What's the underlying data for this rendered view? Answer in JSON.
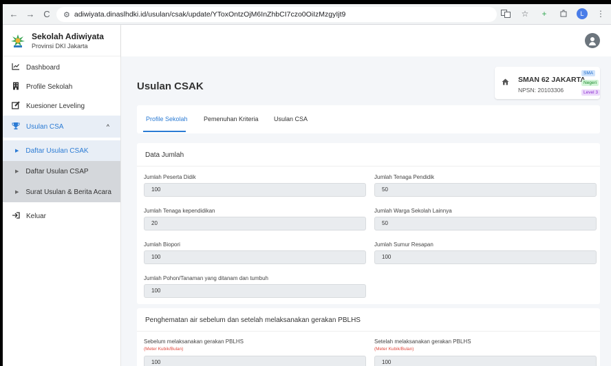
{
  "browser": {
    "url": "adiwiyata.dinaslhdki.id/usulan/csak/update/YToxOntzOjM6InZhbCI7czo0OiIzMzgyIjt9",
    "back_icon": "←",
    "forward_icon": "→",
    "reload_icon": "C",
    "profile_initial": "L"
  },
  "brand": {
    "title": "Sekolah Adiwiyata",
    "subtitle": "Provinsi DKI Jakarta"
  },
  "sidebar": {
    "items": [
      {
        "label": "Dashboard",
        "icon": "chart-line-icon"
      },
      {
        "label": "Profile Sekolah",
        "icon": "building-icon"
      },
      {
        "label": "Kuesioner Leveling",
        "icon": "edit-icon"
      },
      {
        "label": "Usulan CSA",
        "icon": "trophy-icon"
      },
      {
        "label": "Keluar",
        "icon": "logout-icon"
      }
    ],
    "subitems": [
      {
        "label": "Daftar Usulan CSAK"
      },
      {
        "label": "Daftar Usulan CSAP"
      },
      {
        "label": "Surat Usulan & Berita Acara"
      }
    ]
  },
  "page": {
    "title": "Usulan CSAK"
  },
  "school": {
    "name": "SMAN 62 JAKARTA",
    "npsn": "NPSN: 20103306",
    "badges": [
      "SMA",
      "Negeri",
      "Level 3"
    ]
  },
  "tabs": [
    {
      "label": "Profile Sekolah"
    },
    {
      "label": "Pemenuhan Kriteria"
    },
    {
      "label": "Usulan CSA"
    }
  ],
  "data_jumlah": {
    "title": "Data Jumlah",
    "fields": [
      {
        "label": "Jumlah Peserta Didik",
        "value": "100"
      },
      {
        "label": "Jumlah Tenaga Pendidik",
        "value": "50"
      },
      {
        "label": "Jumlah Tenaga kependidikan",
        "value": "20"
      },
      {
        "label": "Jumlah Warga Sekolah Lainnya",
        "value": "50"
      },
      {
        "label": "Jumlah Biopori",
        "value": "100"
      },
      {
        "label": "Jumlah Sumur Resapan",
        "value": "100"
      },
      {
        "label": "Jumlah Pohon/Tanaman yang ditanam dan tumbuh",
        "value": "100"
      }
    ]
  },
  "penghematan": {
    "title": "Penghematan air sebelum dan setelah melaksanakan gerakan PBLHS",
    "fields": [
      {
        "label": "Sebelum melaksanakan gerakan PBLHS",
        "hint": "(Meter Kubik/Bulan)",
        "value": "100"
      },
      {
        "label": "Setelah melaksanakan gerakan PBLHS",
        "hint": "(Meter Kubik/Bulan)",
        "value": "100"
      }
    ]
  }
}
